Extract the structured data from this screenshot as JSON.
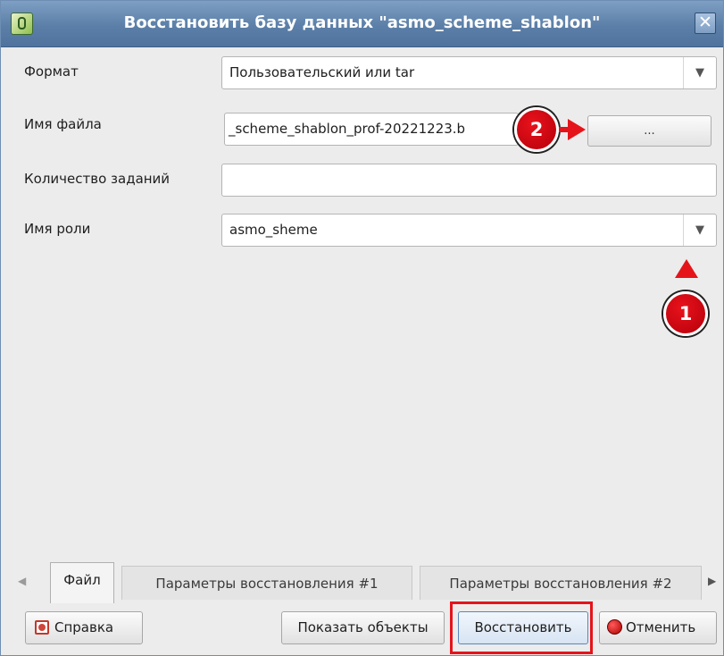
{
  "window": {
    "title": "Восстановить базу данных \"asmo_scheme_shablon\"",
    "close_glyph": "✕"
  },
  "form": {
    "format_label": "Формат",
    "format_value": "Пользовательский или tar",
    "filename_label": "Имя файла",
    "filename_value": "_scheme_shablon_prof-20221223.b",
    "browse_label": "...",
    "jobs_label": "Количество заданий",
    "jobs_value": "",
    "role_label": "Имя роли",
    "role_value": "asmo_sheme"
  },
  "tabs": [
    {
      "label": "Файл",
      "active": true
    },
    {
      "label": "Параметры восстановления #1",
      "active": false
    },
    {
      "label": "Параметры восстановления #2",
      "active": false
    }
  ],
  "buttons": {
    "help_label": "Справка",
    "show_objects_label": "Показать объекты",
    "restore_label": "Восстановить",
    "cancel_label": "Отменить"
  },
  "annotations": {
    "marker_1": "1",
    "marker_2": "2"
  },
  "colors": {
    "titlebar": "#5b7fa8",
    "annotation_red": "#e5141b"
  },
  "icons": {
    "dropdown": "triangle-down",
    "tab_left": "triangle-left",
    "tab_right": "triangle-right"
  }
}
